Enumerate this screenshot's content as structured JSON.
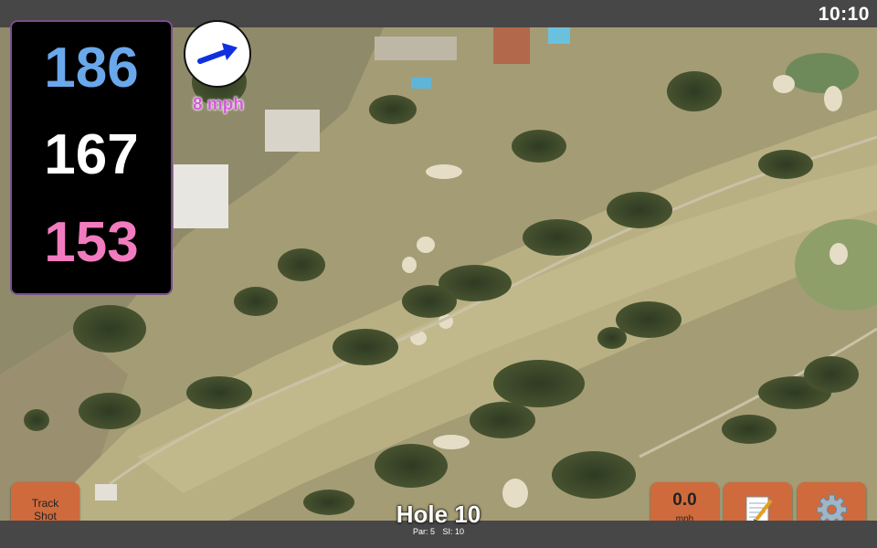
{
  "status_bar": {
    "time": "10:10"
  },
  "distances": {
    "back": "186",
    "middle": "167",
    "front": "153"
  },
  "wind": {
    "speed_label": "8 mph",
    "icon": "wind-arrow-icon",
    "direction": "east-northeast"
  },
  "buttons": {
    "track_shot": {
      "line1": "Track",
      "line2": "Shot"
    },
    "speed": {
      "value": "0.0",
      "unit": "mph"
    },
    "notes_icon": "notepad-icon",
    "settings_icon": "gear-icon"
  },
  "hole": {
    "title": "Hole 10",
    "par_label": "Par: 5",
    "si_label": "SI: 10"
  },
  "colors": {
    "back": "#6aa8ec",
    "middle": "#ffffff",
    "front": "#f27bbf",
    "button": "#cf6a3d",
    "wind_label": "#d35ad7",
    "arrow": "#1030e0"
  }
}
